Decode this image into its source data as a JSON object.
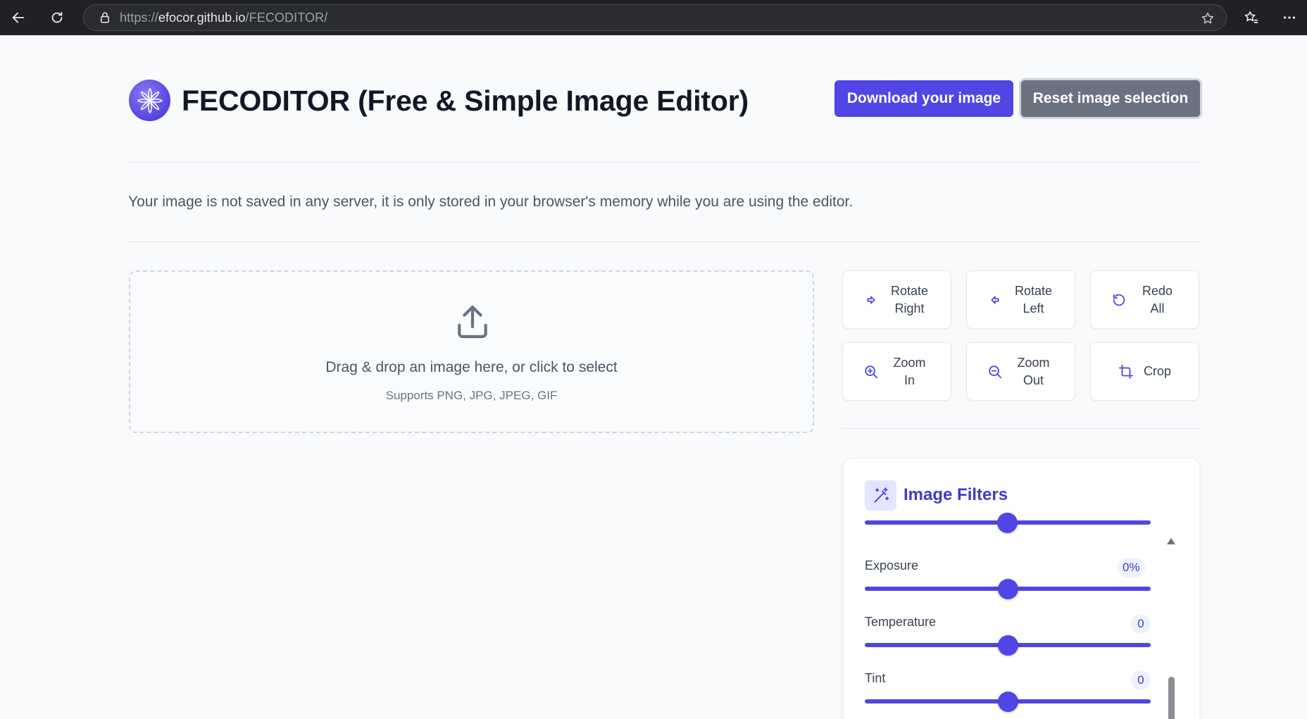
{
  "browser": {
    "url_scheme": "https://",
    "url_host": "efocor.github.io",
    "url_path": "/FECODITOR/"
  },
  "header": {
    "title": "FECODITOR (Free & Simple Image Editor)",
    "download_label": "Download your image",
    "reset_label": "Reset image selection"
  },
  "notice": "Your image is not saved in any server, it is only stored in your browser's memory while you are using the editor.",
  "dropzone": {
    "main_text": "Drag & drop an image here, or click to select",
    "sub_text": "Supports PNG, JPG, JPEG, GIF"
  },
  "tools": [
    {
      "label": "Rotate Right",
      "icon": "rotate-right-icon"
    },
    {
      "label": "Rotate Left",
      "icon": "rotate-left-icon"
    },
    {
      "label": "Redo All",
      "icon": "redo-all-icon"
    },
    {
      "label": "Zoom In",
      "icon": "zoom-in-icon"
    },
    {
      "label": "Zoom Out",
      "icon": "zoom-out-icon"
    },
    {
      "label": "Crop",
      "icon": "crop-icon"
    }
  ],
  "filters": {
    "title": "Image Filters",
    "items": [
      {
        "label": "Exposure",
        "value": "0%",
        "level": 0.5
      },
      {
        "label": "Temperature",
        "value": "0",
        "level": 0.5
      },
      {
        "label": "Tint",
        "value": "0",
        "level": 0.5
      }
    ]
  },
  "colors": {
    "accent": "#4f46e5",
    "reset_button": "#6b7280"
  }
}
